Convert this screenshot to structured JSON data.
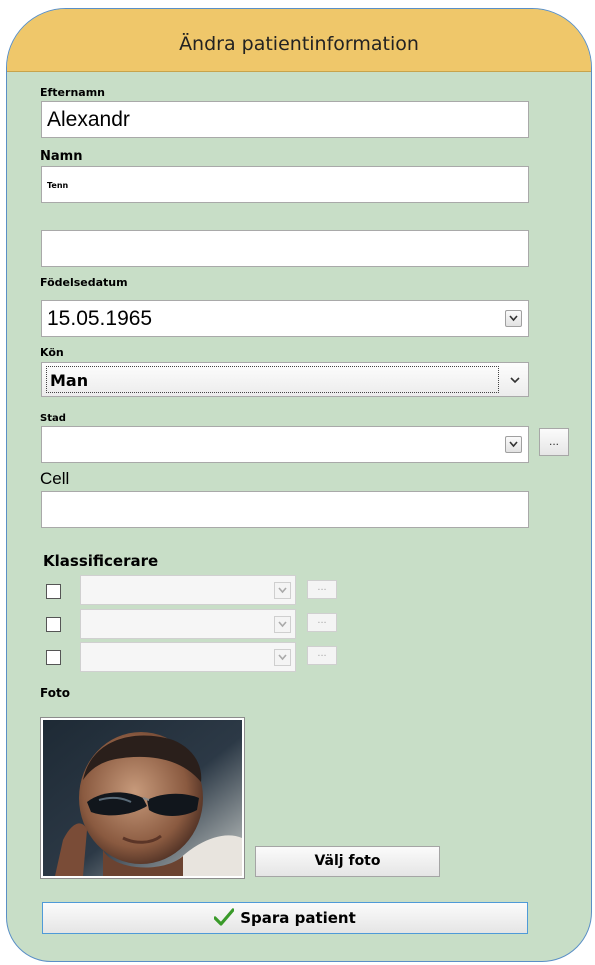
{
  "window": {
    "title": "Ändra patientinformation"
  },
  "form": {
    "surname_label": "Efternamn",
    "surname_value": "Alexandr",
    "name_label": "Namn",
    "name_value": "Tenn",
    "extra_value": "",
    "birthdate_label": "Födelsedatum",
    "birthdate_value": "15.05.1965",
    "gender_label": "Kön",
    "gender_value": "Man",
    "city_label": "Stad",
    "city_value": "",
    "city_more_label": "...",
    "cell_label": "Cell",
    "cell_value": ""
  },
  "classifiers": {
    "heading": "Klassificerare",
    "more_label": "...",
    "rows": [
      {
        "checked": false,
        "value": ""
      },
      {
        "checked": false,
        "value": ""
      },
      {
        "checked": false,
        "value": ""
      }
    ]
  },
  "photo": {
    "label": "Foto",
    "choose_button": "Välj foto"
  },
  "save": {
    "label": "Spara patient",
    "icon": "checkmark-icon",
    "icon_color": "#3a9a2a"
  },
  "colors": {
    "background": "#c8dec7",
    "titlebar": "#efc76a",
    "close_corner": "#d9533d",
    "border": "#5a8fc6"
  }
}
